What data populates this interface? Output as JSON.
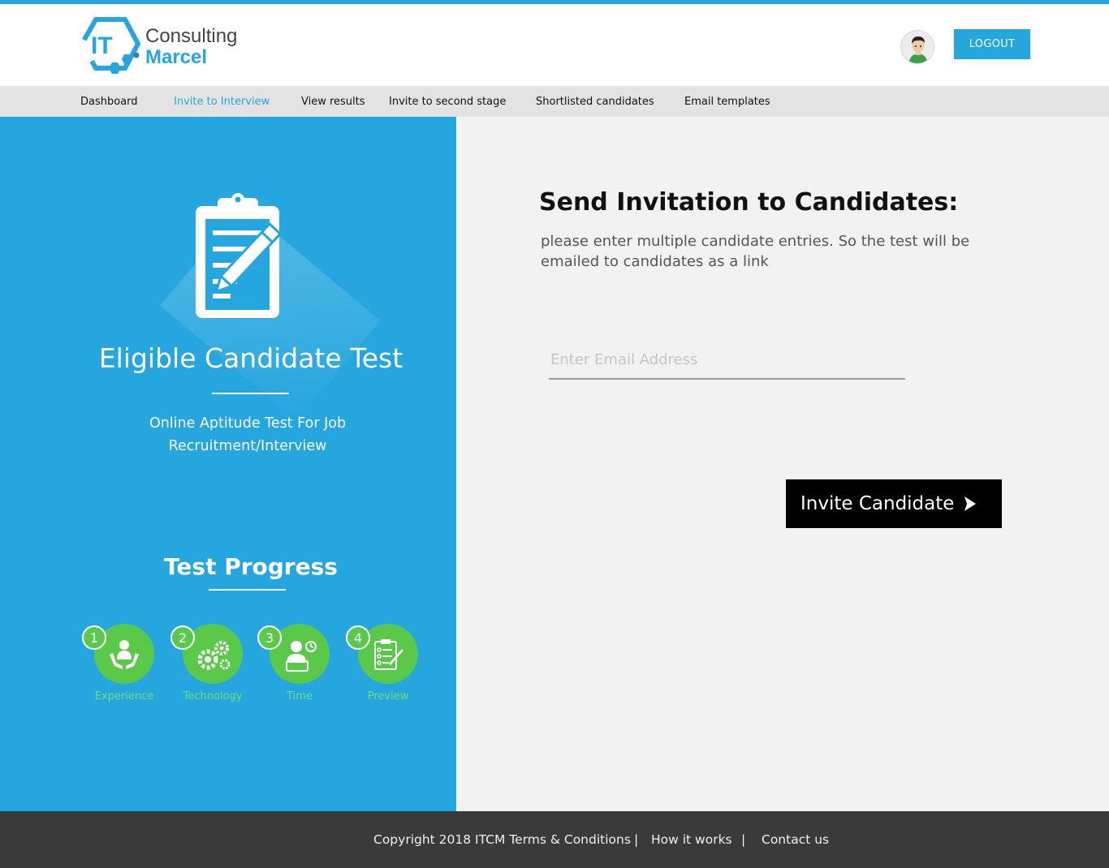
{
  "brand": {
    "logo_mark": "IT",
    "line1": "Consulting",
    "line2": "Marcel",
    "accent_color": "#25a6de"
  },
  "header": {
    "avatar_icon": "user-avatar-icon",
    "logout_label": "LOGOUT"
  },
  "nav": {
    "items": [
      {
        "label": "Dashboard",
        "active": false
      },
      {
        "label": "Invite to Interview",
        "active": true
      },
      {
        "label": "View results",
        "active": false
      },
      {
        "label": "Invite to second stage",
        "active": false
      },
      {
        "label": "Shortlisted candidates",
        "active": false
      },
      {
        "label": "Email templates",
        "active": false
      }
    ]
  },
  "left": {
    "icon": "clipboard-pencil-icon",
    "title": "Eligible Candidate Test",
    "subtitle": "Online Aptitude Test For Job Recruitment/Interview",
    "progress_title": "Test Progress",
    "steps": [
      {
        "number": "1",
        "label": "Experience",
        "icon": "hands-person-icon"
      },
      {
        "number": "2",
        "label": "Technology",
        "icon": "gears-icon"
      },
      {
        "number": "3",
        "label": "Time",
        "icon": "person-clock-icon"
      },
      {
        "number": "4",
        "label": "Preview",
        "icon": "checklist-icon"
      }
    ],
    "step_color": "#5ac94a"
  },
  "right": {
    "title": "Send Invitation to Candidates:",
    "description": "please enter multiple candidate entries. So the test will be emailed to candidates as a link",
    "email_placeholder": "Enter Email Address",
    "email_value": "",
    "invite_label": "Invite Candidate"
  },
  "footer": {
    "copyright": "Copyright 2018 ITCM Terms & Conditions",
    "separator": "|",
    "how_it_works": "How it works",
    "contact": "Contact us"
  }
}
